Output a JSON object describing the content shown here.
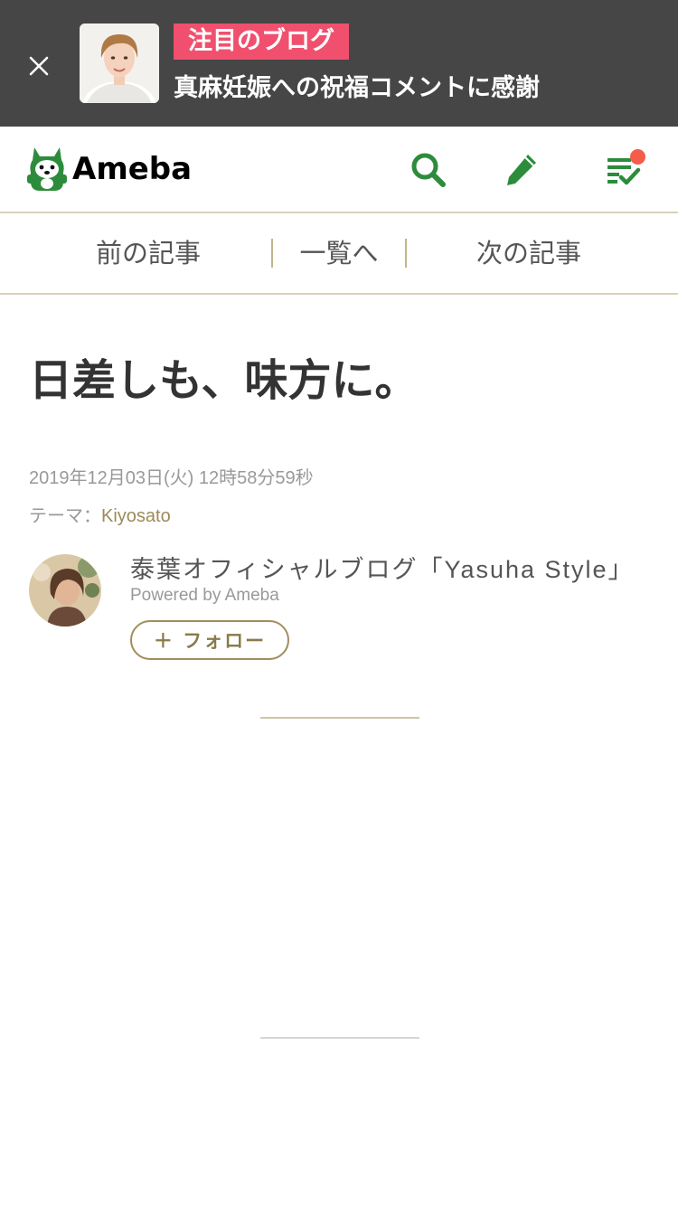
{
  "banner": {
    "tag": "注目のブログ",
    "title": "真麻妊娠への祝福コメントに感謝",
    "close_icon": "close-icon"
  },
  "header": {
    "logo_text": "Ameba",
    "icons": [
      "search-icon",
      "pen-icon",
      "feed-check-icon"
    ],
    "notification_dot_color": "#f55c4a",
    "brand_color": "#2d8c3c"
  },
  "nav": {
    "prev": "前の記事",
    "list": "一覧へ",
    "next": "次の記事"
  },
  "article": {
    "title": "日差しも、味方に。",
    "date": "2019年12月03日(火) 12時58分59秒",
    "theme_label": "テーマ：",
    "theme_value": "Kiyosato"
  },
  "author": {
    "blog_name": "泰葉オフィシャルブログ「Yasuha Style」",
    "powered_by": "Powered by Ameba",
    "follow_label": "＋ フォロー"
  },
  "colors": {
    "banner_bg": "#464646",
    "tag_bg": "#f0506e",
    "accent_gold": "#a08e5c"
  }
}
